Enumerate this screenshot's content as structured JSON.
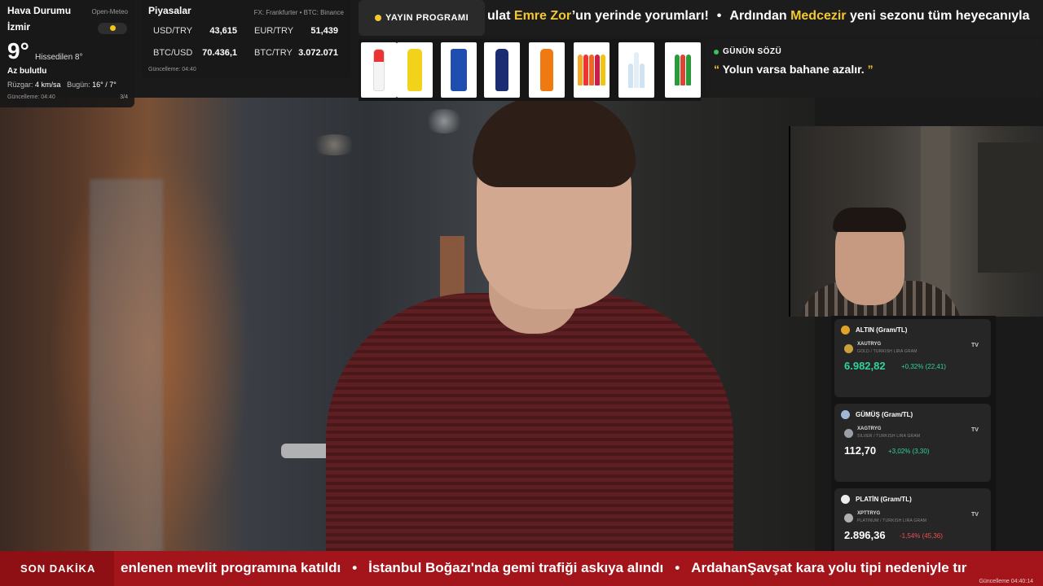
{
  "weather": {
    "title": "Hava Durumu",
    "source": "Open-Meteo",
    "city": "İzmir",
    "temp": "9°",
    "feels": "Hissedilen 8°",
    "condition": "Az bulutlu",
    "wind_label": "Rüzgar:",
    "wind_value": "4 km/sa",
    "today_label": "Bugün:",
    "today_value": "16° / 7°",
    "updated": "Güncelleme: 04:40",
    "page": "3/4",
    "icon": "sun-icon"
  },
  "markets": {
    "title": "Piyasalar",
    "source": "FX: Frankfurter • BTC: Binance",
    "rows": [
      {
        "label": "USD/TRY",
        "value": "43,615"
      },
      {
        "label": "EUR/TRY",
        "value": "51,439"
      },
      {
        "label": "BTC/USD",
        "value": "70.436,1"
      },
      {
        "label": "BTC/TRY",
        "value": "3.072.071"
      }
    ],
    "updated": "Güncelleme: 04:40"
  },
  "schedule": {
    "label": "YAYIN PROGRAMI",
    "ticker": {
      "part1": "ulat ",
      "highlight1": "Emre Zor",
      "part2": "’un yerinde yorumları!",
      "sep": "•",
      "part3": "Ardından ",
      "highlight2": "Medcezir",
      "part4": " yeni sezonu tüm heyecanıyla"
    }
  },
  "products": [
    {
      "name": "water-bottle-red",
      "color": "#e33"
    },
    {
      "name": "soda-yellow",
      "color": "#f2d21a"
    },
    {
      "name": "can-blue",
      "color": "#1e4fb0"
    },
    {
      "name": "bottle-navy",
      "color": "#1b2c72"
    },
    {
      "name": "orange-drink",
      "color": "#f07a12"
    },
    {
      "name": "multi-bottles",
      "color": "#e35"
    },
    {
      "name": "water-bottles",
      "color": "#bcd"
    },
    {
      "name": "green-bottles",
      "color": "#2a9a3a"
    }
  ],
  "quote": {
    "label": "GÜNÜN SÖZÜ",
    "open": "“",
    "text": " Yolun varsa bahane azalır. ",
    "close": "”"
  },
  "metals": [
    {
      "title": "ALTIN (Gram/TL)",
      "symbol": "XAUTRYG",
      "desc": "GOLD / TURKISH LIRA GRAM",
      "price": "6.982,82",
      "change": "+0,32% (22,41)",
      "direction": "up",
      "icon": "medal-gold-icon",
      "color": "#e0a32a"
    },
    {
      "title": "GÜMÜŞ (Gram/TL)",
      "symbol": "XAGTRYG",
      "desc": "SILVER / TURKISH LIRA GRAM",
      "price": "112,70",
      "change": "+3,02% (3,30)",
      "direction": "up",
      "icon": "medal-silver-icon",
      "color": "#9fb8d8"
    },
    {
      "title": "PLATİN (Gram/TL)",
      "symbol": "XPTTRYG",
      "desc": "PLATINUM / TURKISH LIRA GRAM",
      "price": "2.896,36",
      "change": "-1,54% (45,36)",
      "direction": "down",
      "icon": "platinum-icon",
      "color": "#eeeeee"
    }
  ],
  "breaking": {
    "label": "SON DAKİKA",
    "items": [
      "enlenen mevlit programına katıldı",
      "İstanbul Boğazı'nda gemi trafiği askıya alındı",
      "ArdahanŞavşat kara yolu tipi nedeniyle tır"
    ],
    "sep": "•",
    "updated": "Güncelleme 04:40:14"
  },
  "metal_tv_mark": "TV"
}
